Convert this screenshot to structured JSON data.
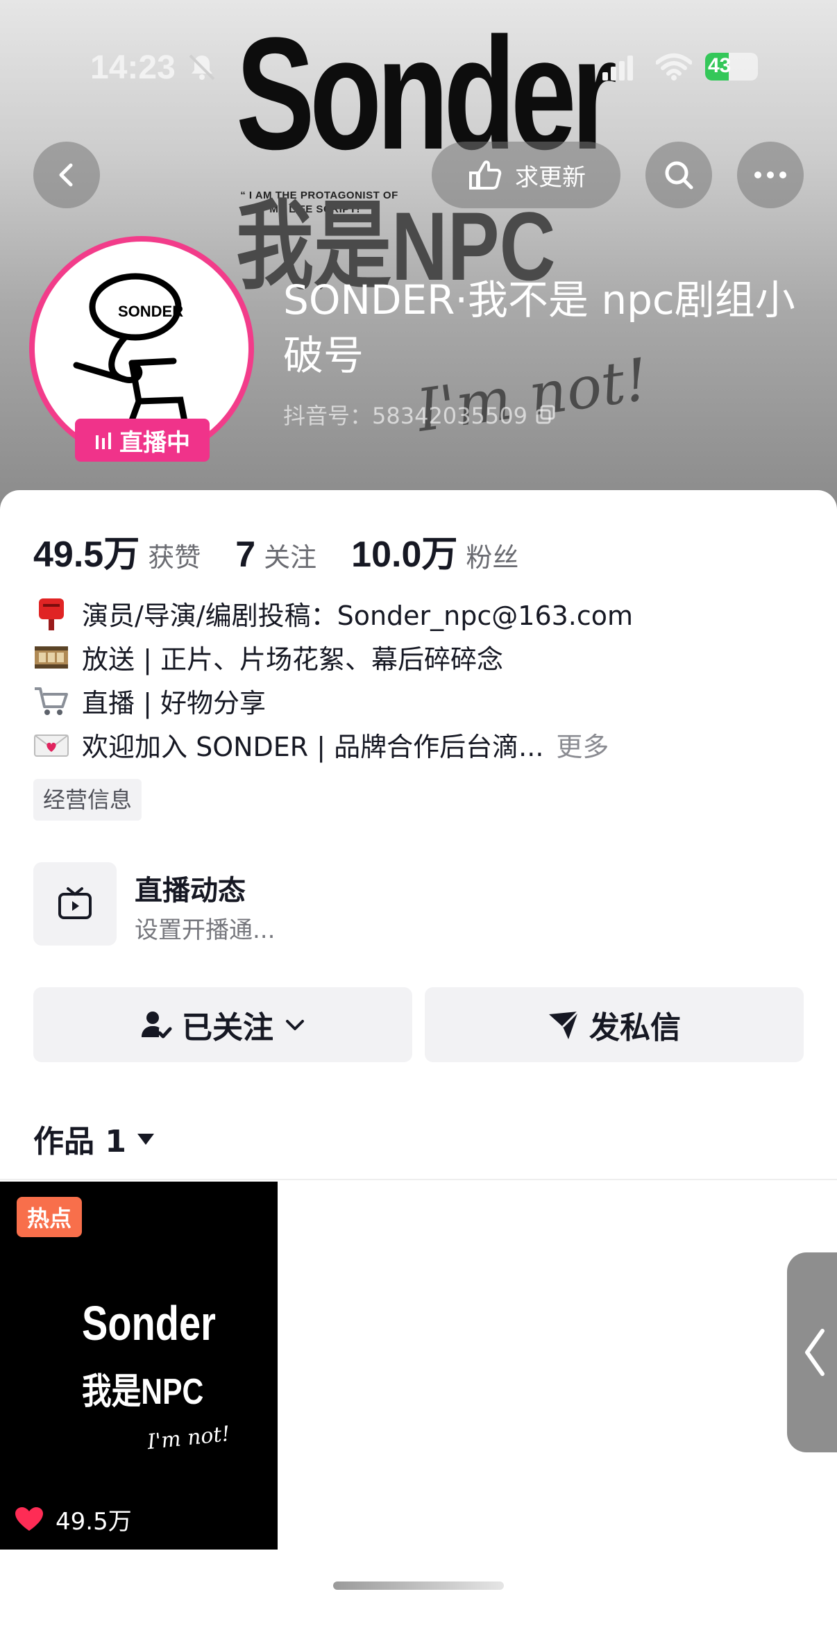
{
  "status_bar": {
    "time": "14:23",
    "battery": "43"
  },
  "cover": {
    "title": "Sonder",
    "quote": "“ I AM THE PROTAGONIST OF MY LIFE SCRIPT! ”",
    "npc_text": "我是NPC",
    "script_text": "I'm not!"
  },
  "header": {
    "request_update_label": "求更新"
  },
  "profile": {
    "name": "SONDER·我不是 npc剧组小破号",
    "douyin_id": "抖音号：58342035509",
    "live_badge": "直播中",
    "avatar_text": "SONDER"
  },
  "stats": [
    {
      "value": "49.5万",
      "label": "获赞"
    },
    {
      "value": "7",
      "label": "关注"
    },
    {
      "value": "10.0万",
      "label": "粉丝"
    }
  ],
  "bio": [
    {
      "icon": "postbox-icon",
      "text": "演员/导演/编剧投稿：Sonder_npc@163.com"
    },
    {
      "icon": "film-icon",
      "text": "放送 | 正片、片场花絮、幕后碎碎念"
    },
    {
      "icon": "cart-icon",
      "text": "直播 | 好物分享"
    },
    {
      "icon": "love-letter-icon",
      "text": "欢迎加入 SONDER | 品牌合作后台滴..."
    }
  ],
  "bio_more_label": "更多",
  "business_tag": "经营信息",
  "live_section": {
    "title": "直播动态",
    "subtitle": "设置开播通..."
  },
  "actions": {
    "follow_label": "已关注",
    "message_label": "发私信"
  },
  "works_tab": {
    "label": "作品 1"
  },
  "works": [
    {
      "badge": "热点",
      "cover_title": "Sonder",
      "cover_subtitle": "我是NPC",
      "cover_script": "I'm not!",
      "likes": "49.5万"
    }
  ],
  "colors": {
    "live_pink": "#f0338a",
    "hot_orange": "#f86f4b",
    "like_red": "#fe2c55"
  }
}
